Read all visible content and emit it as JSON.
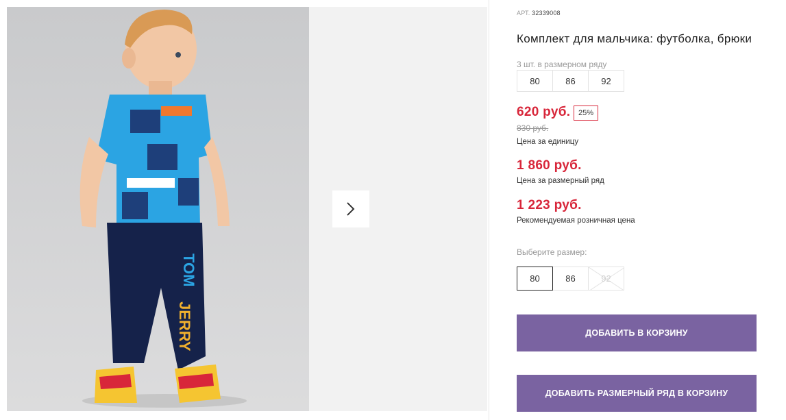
{
  "gallery": {
    "image_alt": "Boy in blue Tom and Jerry t-shirt and navy pants",
    "next_icon": "chevron-right-icon"
  },
  "product": {
    "art_label": "АРТ.",
    "art_number": "32339008",
    "title": "Комплект для мальчика: футболка, брюки"
  },
  "size_range": {
    "hint": "3 шт. в размерном ряду",
    "sizes": [
      "80",
      "86",
      "92"
    ]
  },
  "prices": {
    "unit_price": "620 руб.",
    "discount": "25%",
    "old_price": "830 руб.",
    "unit_label": "Цена за единицу",
    "range_price": "1 860 руб.",
    "range_label": "Цена за размерный ряд",
    "rrp_price": "1 223 руб.",
    "rrp_label": "Рекомендуемая розничная цена"
  },
  "size_select": {
    "hint": "Выберите размер:",
    "options": [
      "80",
      "86",
      "92"
    ],
    "selected": "80",
    "unavailable": [
      "92"
    ]
  },
  "actions": {
    "add_to_cart": "ДОБАВИТЬ В КОРЗИНУ",
    "add_range_to_cart": "ДОБАВИТЬ РАЗМЕРНЫЙ РЯД В КОРЗИНУ"
  },
  "colors": {
    "accent": "#7a63a1",
    "price": "#d8263a"
  }
}
